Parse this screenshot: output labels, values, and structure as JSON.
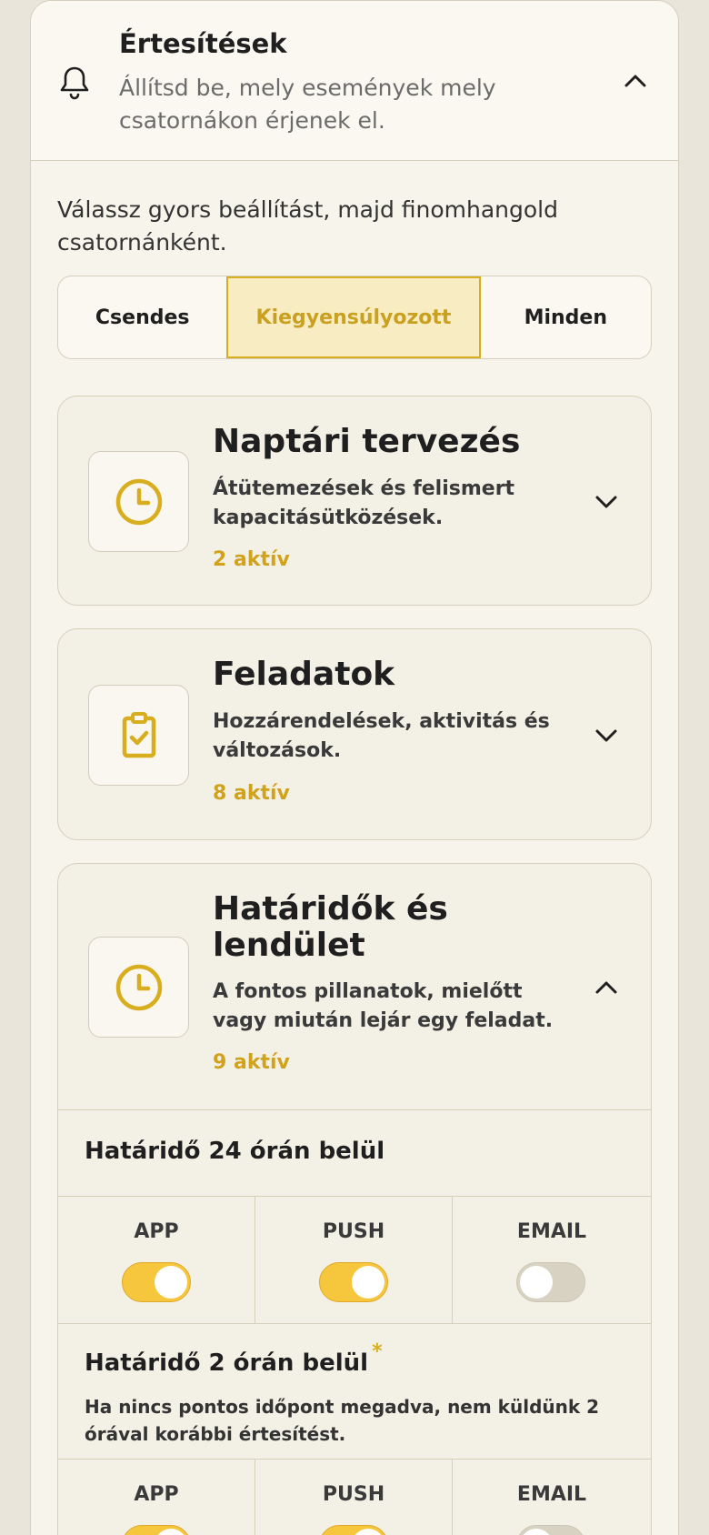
{
  "header": {
    "title": "Értesítések",
    "subtitle": "Állítsd be, mely események mely csatornákon érjenek el."
  },
  "intro": "Válassz gyors beállítást, majd finomhangold csatornánként.",
  "presets": {
    "items": [
      "Csendes",
      "Kiegyensúlyozott",
      "Minden"
    ],
    "selected": "Kiegyensúlyozott"
  },
  "categories": [
    {
      "title": "Naptári tervezés",
      "desc": "Átütemezések és felismert kapacitásütközések.",
      "count": "2 aktív",
      "icon": "clock-icon",
      "expanded": false
    },
    {
      "title": "Feladatok",
      "desc": "Hozzárendelések, aktivitás és változások.",
      "count": "8 aktív",
      "icon": "clipboard-check-icon",
      "expanded": false
    },
    {
      "title": "Határidők és lendület",
      "desc": "A fontos pillanatok, mielőtt vagy miután lejár egy feladat.",
      "count": "9 aktív",
      "icon": "clock-icon",
      "expanded": true
    }
  ],
  "rules": [
    {
      "title": "Határidő 24 órán belül",
      "note": "",
      "channels": [
        {
          "label": "APP",
          "on": true
        },
        {
          "label": "PUSH",
          "on": true
        },
        {
          "label": "EMAIL",
          "on": false
        }
      ]
    },
    {
      "title": "Határidő 2 órán belül",
      "star": "*",
      "note": "Ha nincs pontos időpont megadva, nem küldünk 2 órával korábbi értesítést.",
      "channels": [
        {
          "label": "APP",
          "on": true
        },
        {
          "label": "PUSH",
          "on": true
        },
        {
          "label": "EMAIL",
          "on": false
        }
      ]
    }
  ],
  "colors": {
    "accent": "#d8ae1f",
    "toggle_on": "#f6c63d",
    "toggle_off": "#d8d2c2",
    "background": "#f7f4ec"
  }
}
